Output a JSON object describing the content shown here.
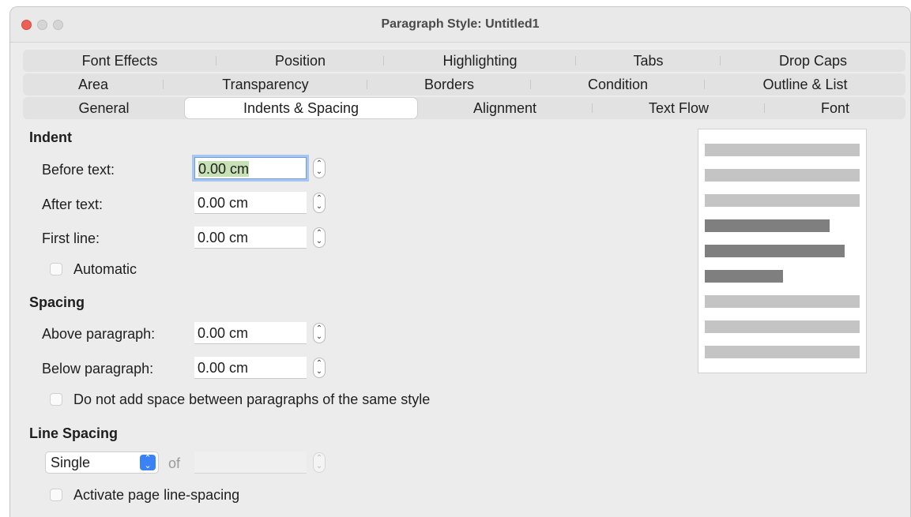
{
  "window": {
    "title": "Paragraph Style: Untitled1"
  },
  "tabs": {
    "row1": [
      "Font Effects",
      "Position",
      "Highlighting",
      "Tabs",
      "Drop Caps"
    ],
    "row2": [
      "Area",
      "Transparency",
      "Borders",
      "Condition",
      "Outline & List"
    ],
    "row3": [
      "General",
      "Indents & Spacing",
      "Alignment",
      "Text Flow",
      "Font"
    ],
    "active": "Indents & Spacing"
  },
  "indent": {
    "title": "Indent",
    "before_text_label": "Before text:",
    "before_text_value": "0.00 cm",
    "after_text_label": "After text:",
    "after_text_value": "0.00 cm",
    "first_line_label": "First line:",
    "first_line_value": "0.00 cm",
    "automatic_label": "Automatic",
    "automatic_checked": false
  },
  "spacing": {
    "title": "Spacing",
    "above_label": "Above paragraph:",
    "above_value": "0.00 cm",
    "below_label": "Below paragraph:",
    "below_value": "0.00 cm",
    "no_space_label": "Do not add space between paragraphs of the same style",
    "no_space_checked": false
  },
  "line_spacing": {
    "title": "Line Spacing",
    "selected": "Single",
    "of_label": "of",
    "of_value": "",
    "activate_label": "Activate page line-spacing",
    "activate_checked": false
  },
  "colors": {
    "close": "#ec5f57",
    "accent": "#3b82f6",
    "selection": "#c7e0b5",
    "preview_light": "#c4c4c4",
    "preview_dark": "#7f7f7f"
  }
}
